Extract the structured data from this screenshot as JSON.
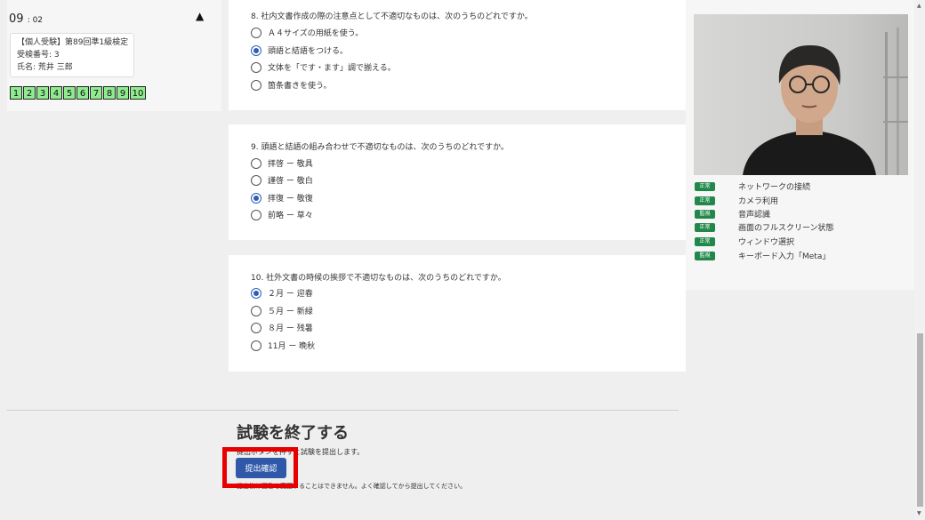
{
  "timer": {
    "minutes": "09",
    "seconds": ": 02"
  },
  "examinee": {
    "exam_name": "【個人受験】第89回準1級検定",
    "examinee_number": "受検番号: 3",
    "name": "氏名: 荒井 三郎"
  },
  "question_nav": [
    "1",
    "2",
    "3",
    "4",
    "5",
    "6",
    "7",
    "8",
    "9",
    "10"
  ],
  "questions": [
    {
      "text": "8. 社内文書作成の際の注意点として不適切なものは、次のうちのどれですか。",
      "options": [
        "Ａ４サイズの用紙を使う。",
        "頭語と結語をつける。",
        "文体を「です・ます」調で揃える。",
        "箇条書きを使う。"
      ],
      "selected_index": 1
    },
    {
      "text": "9. 頭語と結語の組み合わせで不適切なものは、次のうちのどれですか。",
      "options": [
        "拝啓 ー 敬具",
        "謹啓 ー 敬白",
        "拝復 ー 敬復",
        "前略 ー 草々"
      ],
      "selected_index": 2
    },
    {
      "text": "10. 社外文書の時候の挨拶で不適切なものは、次のうちのどれですか。",
      "options": [
        "２月 ー 迎春",
        "５月 ー 新緑",
        "８月 ー 残暑",
        "11月 ー 晩秋"
      ],
      "selected_index": 0
    }
  ],
  "monitoring": [
    {
      "status": "正常",
      "label": "ネットワークの接続"
    },
    {
      "status": "正常",
      "label": "カメラ利用"
    },
    {
      "status": "監視",
      "label": "音声認識"
    },
    {
      "status": "正常",
      "label": "画面のフルスクリーン状態"
    },
    {
      "status": "正常",
      "label": "ウィンドウ選択"
    },
    {
      "status": "監視",
      "label": "キーボード入力「Meta」"
    }
  ],
  "finish": {
    "title": "試験を終了する",
    "description": "提出ボタンを押すと試験を提出します。",
    "button_label": "提出確認",
    "warning": "提出後は回答を変更することはできません。よく確認してから提出してください。"
  },
  "colors": {
    "accent": "#2f58a8",
    "nav_green": "#8eec8e",
    "status_green": "#22884a",
    "highlight_red": "#e80000"
  }
}
